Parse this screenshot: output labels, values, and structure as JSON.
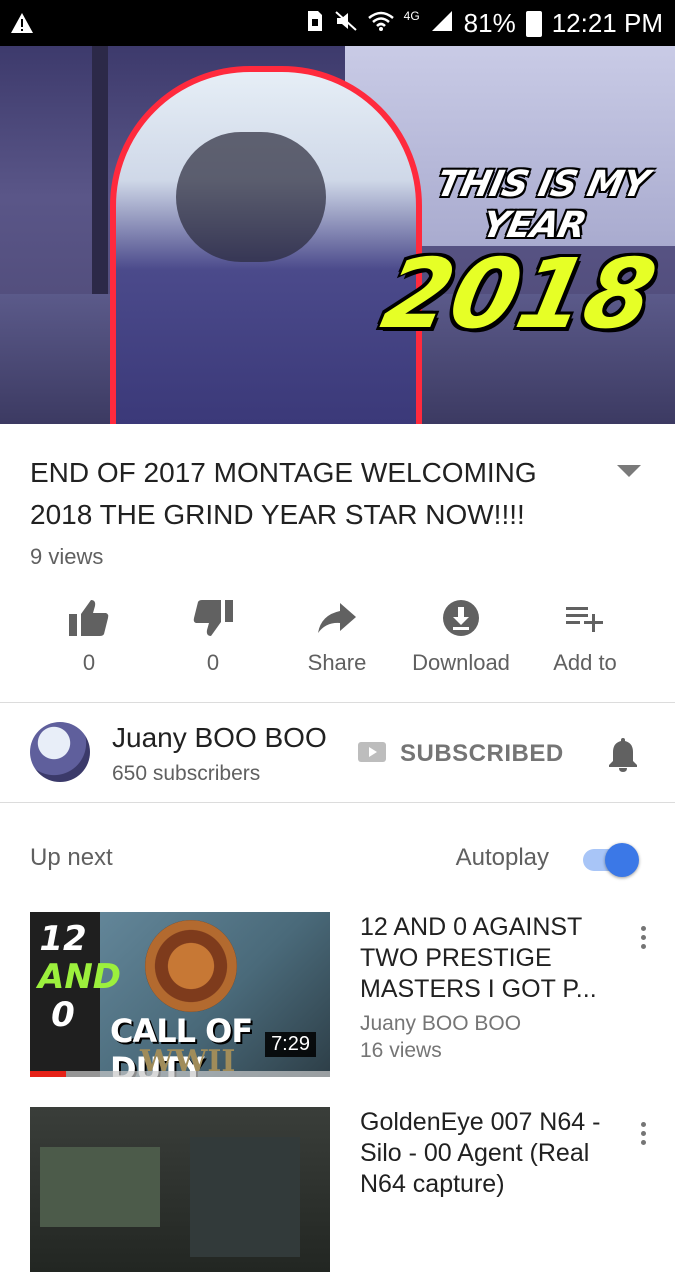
{
  "status_bar": {
    "battery": "81%",
    "time": "12:21 PM",
    "network": "4G"
  },
  "player": {
    "thumbnail_text_line1": "THIS IS MY YEAR",
    "thumbnail_text_line2": "2018"
  },
  "video": {
    "title": "END OF 2017 MONTAGE WELCOMING 2018 THE GRIND YEAR STAR NOW!!!!",
    "views": "9 views"
  },
  "actions": [
    {
      "icon": "thumb-up-icon",
      "label": "0"
    },
    {
      "icon": "thumb-down-icon",
      "label": "0"
    },
    {
      "icon": "share-icon",
      "label": "Share"
    },
    {
      "icon": "download-icon",
      "label": "Download"
    },
    {
      "icon": "add-to-playlist-icon",
      "label": "Add to"
    }
  ],
  "channel": {
    "name": "Juany BOO BOO",
    "subscribers": "650 subscribers",
    "subscribed_label": "SUBSCRIBED"
  },
  "up_next": {
    "label": "Up next",
    "autoplay_label": "Autoplay",
    "autoplay_on": true,
    "accent": "#3b78e7"
  },
  "videos": [
    {
      "title": "12 AND 0 AGAINST TWO PRESTIGE MASTERS I GOT P...",
      "channel": "Juany BOO BOO",
      "views": "16 views",
      "duration": "7:29",
      "thumb_num1": "12",
      "thumb_num2": "AND",
      "thumb_num3": "0",
      "thumb_cod": "CALL OF DUTY",
      "thumb_wwii": "WWII"
    },
    {
      "title": "GoldenEye 007 N64 - Silo - 00 Agent (Real N64 capture)"
    }
  ]
}
